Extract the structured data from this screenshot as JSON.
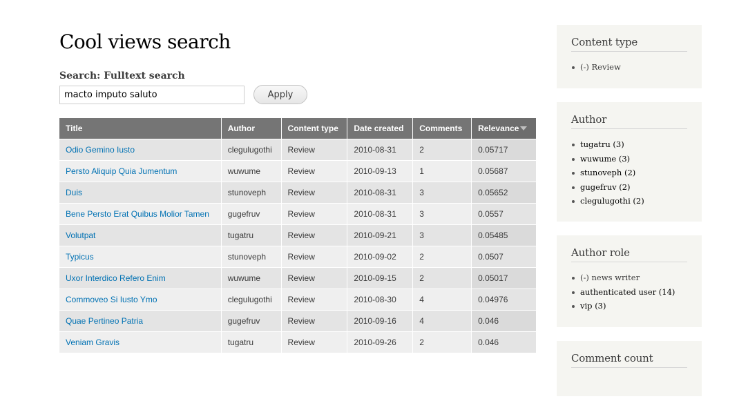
{
  "page": {
    "title": "Cool views search"
  },
  "search": {
    "label": "Search: Fulltext search",
    "value": "macto imputo saluto",
    "placeholder": "",
    "apply_label": "Apply"
  },
  "table": {
    "columns": [
      "Title",
      "Author",
      "Content type",
      "Date created",
      "Comments",
      "Relevance"
    ],
    "sorted_column": "Relevance",
    "sort_direction": "descending",
    "rows": [
      {
        "title": "Odio Gemino Iusto",
        "author": "clegulugothi",
        "content_type": "Review",
        "date": "2010-08-31",
        "comments": "2",
        "relevance": "0.05717"
      },
      {
        "title": "Persto Aliquip Quia Jumentum",
        "author": "wuwume",
        "content_type": "Review",
        "date": "2010-09-13",
        "comments": "1",
        "relevance": "0.05687"
      },
      {
        "title": "Duis",
        "author": "stunoveph",
        "content_type": "Review",
        "date": "2010-08-31",
        "comments": "3",
        "relevance": "0.05652"
      },
      {
        "title": "Bene Persto Erat Quibus Molior Tamen",
        "author": "gugefruv",
        "content_type": "Review",
        "date": "2010-08-31",
        "comments": "3",
        "relevance": "0.0557"
      },
      {
        "title": "Volutpat",
        "author": "tugatru",
        "content_type": "Review",
        "date": "2010-09-21",
        "comments": "3",
        "relevance": "0.05485"
      },
      {
        "title": "Typicus",
        "author": "stunoveph",
        "content_type": "Review",
        "date": "2010-09-02",
        "comments": "2",
        "relevance": "0.0507"
      },
      {
        "title": "Uxor Interdico Refero Enim",
        "author": "wuwume",
        "content_type": "Review",
        "date": "2010-09-15",
        "comments": "2",
        "relevance": "0.05017"
      },
      {
        "title": "Commoveo Si Iusto Ymo",
        "author": "clegulugothi",
        "content_type": "Review",
        "date": "2010-08-30",
        "comments": "4",
        "relevance": "0.04976"
      },
      {
        "title": "Quae Pertineo Patria",
        "author": "gugefruv",
        "content_type": "Review",
        "date": "2010-09-16",
        "comments": "4",
        "relevance": "0.046"
      },
      {
        "title": "Veniam Gravis",
        "author": "tugatru",
        "content_type": "Review",
        "date": "2010-09-26",
        "comments": "2",
        "relevance": "0.046"
      }
    ]
  },
  "sidebar": {
    "blocks": [
      {
        "title": "Content type",
        "items": [
          {
            "remove": "(-)",
            "label": "Review",
            "active": true
          }
        ]
      },
      {
        "title": "Author",
        "items": [
          {
            "label": "tugatru (3)"
          },
          {
            "label": "wuwume (3)"
          },
          {
            "label": "stunoveph (2)"
          },
          {
            "label": "gugefruv (2)"
          },
          {
            "label": "clegulugothi (2)"
          }
        ]
      },
      {
        "title": "Author role",
        "items": [
          {
            "remove": "(-)",
            "label": "news writer",
            "active": true
          },
          {
            "label": "authenticated user (14)"
          },
          {
            "label": "vip (3)"
          }
        ]
      },
      {
        "title": "Comment count",
        "items": []
      }
    ]
  },
  "colors": {
    "link": "#0071b3",
    "header_bg": "#757575",
    "sidebar_bg": "#f5f5f1"
  }
}
